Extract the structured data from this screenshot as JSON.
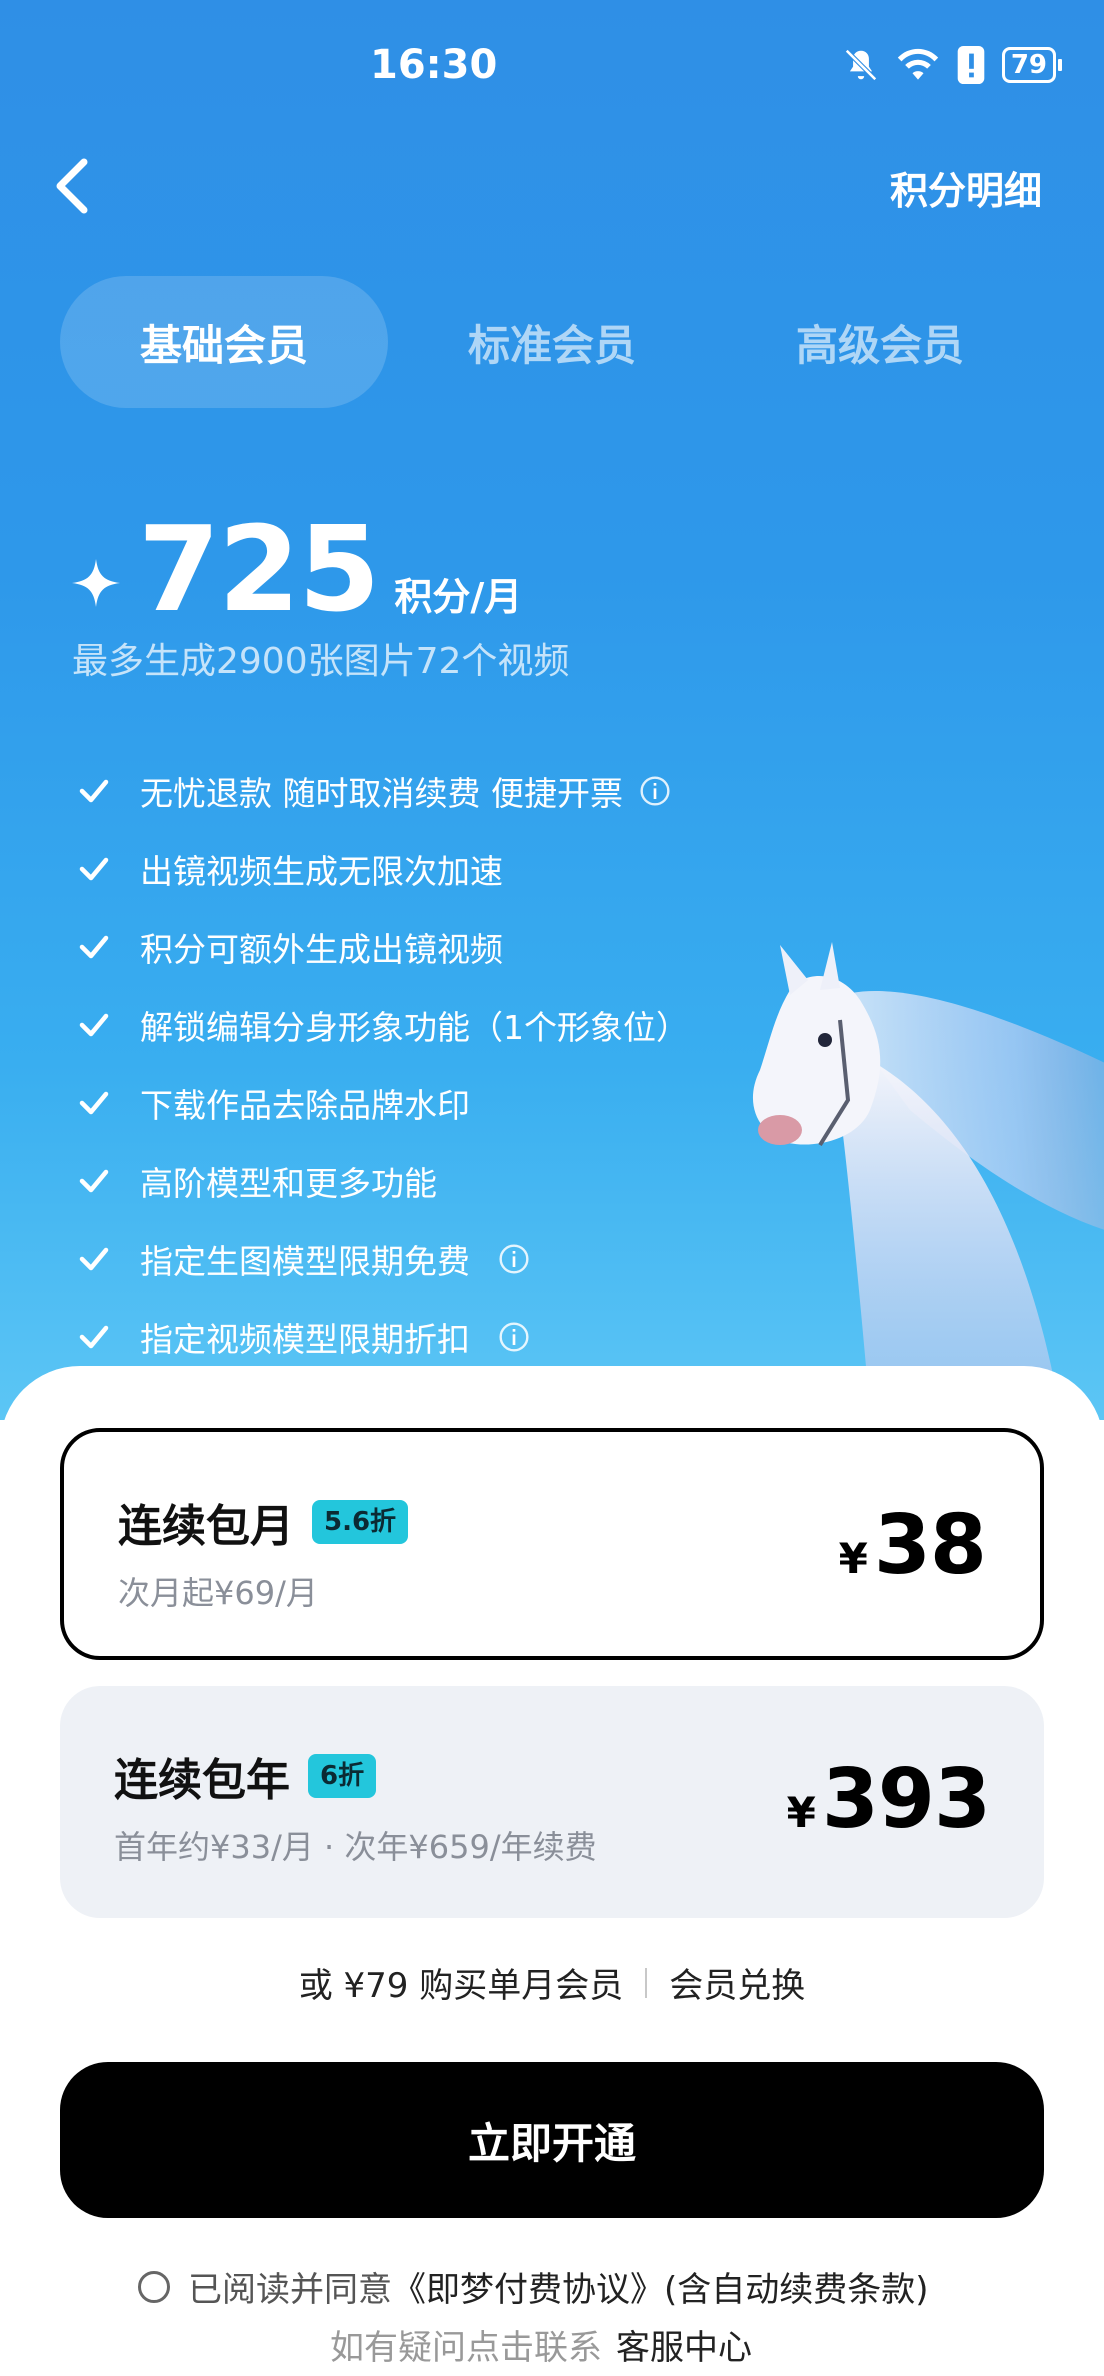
{
  "status_bar": {
    "time": "16:30",
    "battery": "79"
  },
  "header": {
    "points_detail": "积分明细"
  },
  "tabs": [
    {
      "label": "基础会员",
      "active": true
    },
    {
      "label": "标准会员",
      "active": false
    },
    {
      "label": "高级会员",
      "active": false
    }
  ],
  "points": {
    "value": "725",
    "unit": "积分/月",
    "subtitle": "最多生成2900张图片72个视频"
  },
  "features": [
    {
      "text": "无忧退款 随时取消续费 便捷开票"
    },
    {
      "text": "出镜视频生成无限次加速"
    },
    {
      "text": "积分可额外生成出镜视频"
    },
    {
      "text": "解锁编辑分身形象功能（1个形象位）"
    },
    {
      "text": "下载作品去除品牌水印"
    },
    {
      "text": "高阶模型和更多功能"
    },
    {
      "text": "指定生图模型限期免费"
    },
    {
      "text": "指定视频模型限期折扣"
    }
  ],
  "plans": [
    {
      "name": "连续包月",
      "badge": "5.6折",
      "sub": "次月起¥69/月",
      "currency": "¥",
      "price": "38",
      "selected": true
    },
    {
      "name": "连续包年",
      "badge": "6折",
      "sub": "首年约¥33/月 · 次年¥659/年续费",
      "currency": "¥",
      "price": "393",
      "selected": false
    }
  ],
  "alt": {
    "single_month": "或 ¥79 购买单月会员",
    "redeem": "会员兑换"
  },
  "cta": {
    "label": "立即开通"
  },
  "agreement": {
    "prefix": "已阅读并同意",
    "link": "《即梦付费协议》(含自动续费条款)"
  },
  "contact": {
    "prefix": "如有疑问点击联系",
    "link": "客服中心"
  },
  "colors": {
    "accent_badge": "#23c6dc",
    "hero_blue": "#2f8fe6",
    "cta_black": "#000000"
  }
}
